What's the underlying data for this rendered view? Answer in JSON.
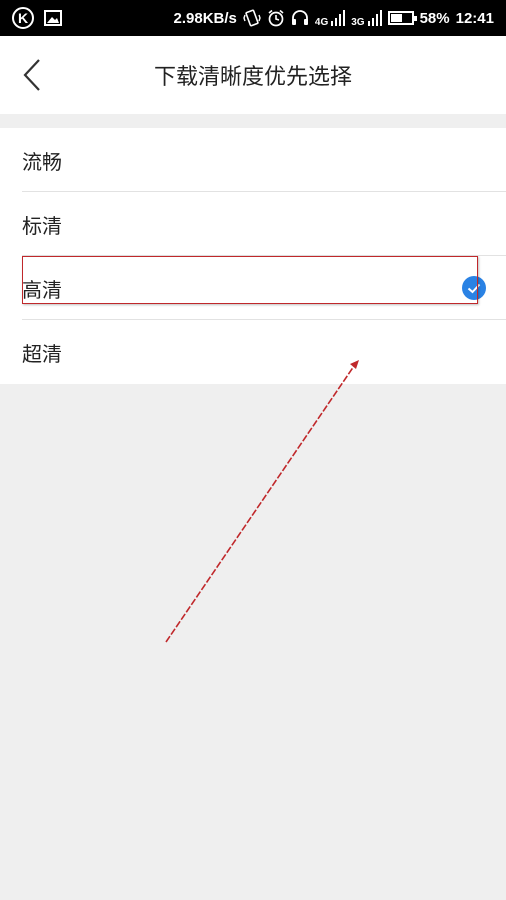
{
  "status_bar": {
    "speed": "2.98KB/s",
    "network_4g": "4G",
    "network_3g": "3G",
    "battery_percent": "58%",
    "time": "12:41",
    "battery_level": 0.58
  },
  "header": {
    "title": "下载清晰度优先选择"
  },
  "options": [
    {
      "label": "流畅",
      "selected": false
    },
    {
      "label": "标清",
      "selected": false
    },
    {
      "label": "高清",
      "selected": true
    },
    {
      "label": "超清",
      "selected": false
    }
  ],
  "colors": {
    "accent": "#2a82e4",
    "annotation": "#c0282b"
  },
  "icons": {
    "back": "chevron-left-icon",
    "check": "check-circle-icon"
  }
}
